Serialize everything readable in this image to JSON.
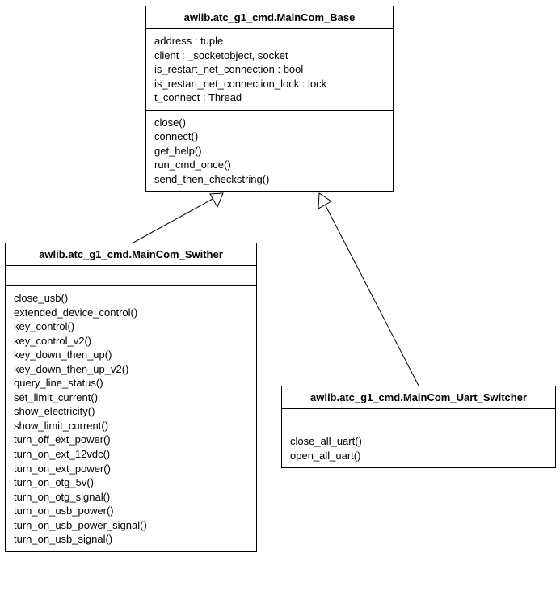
{
  "classes": {
    "base": {
      "title": "awlib.atc_g1_cmd.MainCom_Base",
      "attributes": [
        "address : tuple",
        "client : _socketobject, socket",
        "is_restart_net_connection : bool",
        "is_restart_net_connection_lock : lock",
        "t_connect : Thread"
      ],
      "methods": [
        "close()",
        "connect()",
        "get_help()",
        "run_cmd_once()",
        "send_then_checkstring()"
      ]
    },
    "swither": {
      "title": "awlib.atc_g1_cmd.MainCom_Swither",
      "methods": [
        "close_usb()",
        "extended_device_control()",
        "key_control()",
        "key_control_v2()",
        "key_down_then_up()",
        "key_down_then_up_v2()",
        "query_line_status()",
        "set_limit_current()",
        "show_electricity()",
        "show_limit_current()",
        "turn_off_ext_power()",
        "turn_on_ext_12vdc()",
        "turn_on_ext_power()",
        "turn_on_otg_5v()",
        "turn_on_otg_signal()",
        "turn_on_usb_power()",
        "turn_on_usb_power_signal()",
        "turn_on_usb_signal()"
      ]
    },
    "uart": {
      "title": "awlib.atc_g1_cmd.MainCom_Uart_Switcher",
      "methods": [
        "close_all_uart()",
        "open_all_uart()"
      ]
    }
  }
}
